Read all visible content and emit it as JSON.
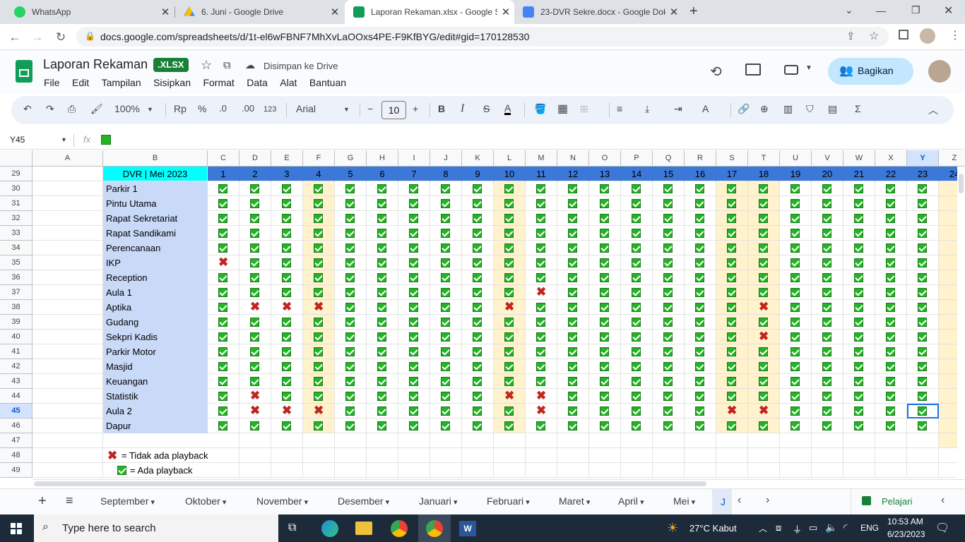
{
  "browser": {
    "tabs": [
      {
        "title": "WhatsApp",
        "color": "#25d366"
      },
      {
        "title": "6. Juni - Google Drive",
        "color": "#fbbc04"
      },
      {
        "title": "Laporan Rekaman.xlsx - Google S",
        "color": "#0f9d58"
      },
      {
        "title": "23-DVR Sekre.docx - Google Dok",
        "color": "#4285f4"
      }
    ],
    "url": "docs.google.com/spreadsheets/d/1t-el6wFBNF7MhXvLaOOxs4PE-F9KfBYG/edit#gid=170128530"
  },
  "doc": {
    "title": "Laporan Rekaman",
    "badge": ".XLSX",
    "saved": "Disimpan ke Drive",
    "share": "Bagikan",
    "menu": [
      "File",
      "Edit",
      "Tampilan",
      "Sisipkan",
      "Format",
      "Data",
      "Alat",
      "Bantuan"
    ]
  },
  "toolbar": {
    "zoom": "100%",
    "currency": "Rp",
    "percent": "%",
    "dec_less": ".0",
    "dec_more": ".00",
    "number_format": "123",
    "font": "Arial",
    "font_size": "10"
  },
  "formula_bar": {
    "cell_ref": "Y45",
    "fx": "fx"
  },
  "grid": {
    "columns": [
      "A",
      "B",
      "C",
      "D",
      "E",
      "F",
      "G",
      "H",
      "I",
      "J",
      "K",
      "L",
      "M",
      "N",
      "O",
      "P",
      "Q",
      "R",
      "S",
      "T",
      "U",
      "V",
      "W",
      "X",
      "Y",
      "Z"
    ],
    "header_row": {
      "row": "29",
      "title": "DVR | Mei 2023",
      "days": [
        "1",
        "2",
        "3",
        "4",
        "5",
        "6",
        "7",
        "8",
        "9",
        "10",
        "11",
        "12",
        "13",
        "14",
        "15",
        "16",
        "17",
        "18",
        "19",
        "20",
        "21",
        "22",
        "23",
        "24"
      ]
    },
    "rows": [
      {
        "n": "30",
        "name": "Parkir 1",
        "x": []
      },
      {
        "n": "31",
        "name": "Pintu Utama",
        "x": []
      },
      {
        "n": "32",
        "name": "Rapat Sekretariat",
        "x": []
      },
      {
        "n": "33",
        "name": "Rapat Sandikami",
        "x": []
      },
      {
        "n": "34",
        "name": "Perencanaan",
        "x": []
      },
      {
        "n": "35",
        "name": "IKP",
        "x": [
          1
        ]
      },
      {
        "n": "36",
        "name": "Reception",
        "x": []
      },
      {
        "n": "37",
        "name": "Aula 1",
        "x": [
          11
        ]
      },
      {
        "n": "38",
        "name": "Aptika",
        "x": [
          2,
          3,
          4,
          10,
          18
        ]
      },
      {
        "n": "39",
        "name": "Gudang",
        "x": []
      },
      {
        "n": "40",
        "name": "Sekpri Kadis",
        "x": [
          18
        ]
      },
      {
        "n": "41",
        "name": "Parkir Motor",
        "x": []
      },
      {
        "n": "42",
        "name": "Masjid",
        "x": []
      },
      {
        "n": "43",
        "name": "Keuangan",
        "x": []
      },
      {
        "n": "44",
        "name": "Statistik",
        "x": [
          2,
          10,
          11
        ]
      },
      {
        "n": "45",
        "name": "Aula 2",
        "x": [
          2,
          3,
          4,
          11,
          17,
          18
        ]
      },
      {
        "n": "46",
        "name": "Dapur",
        "x": []
      }
    ],
    "empty_rows": [
      "47"
    ],
    "legend": [
      {
        "n": "48",
        "text": "= Tidak ada playback"
      },
      {
        "n": "49",
        "text": "= Ada playback"
      }
    ],
    "highlight_days": [
      4,
      10,
      17,
      18,
      24
    ]
  },
  "sheets": [
    "September",
    "Oktober",
    "November",
    "Desember",
    "Januari",
    "Februari",
    "Maret",
    "April",
    "Mei",
    "J"
  ],
  "explore": "Pelajari",
  "taskbar": {
    "search_placeholder": "Type here to search",
    "weather": "27°C  Kabut",
    "lang": "ENG",
    "time": "10:53 AM",
    "date": "6/23/2023"
  }
}
